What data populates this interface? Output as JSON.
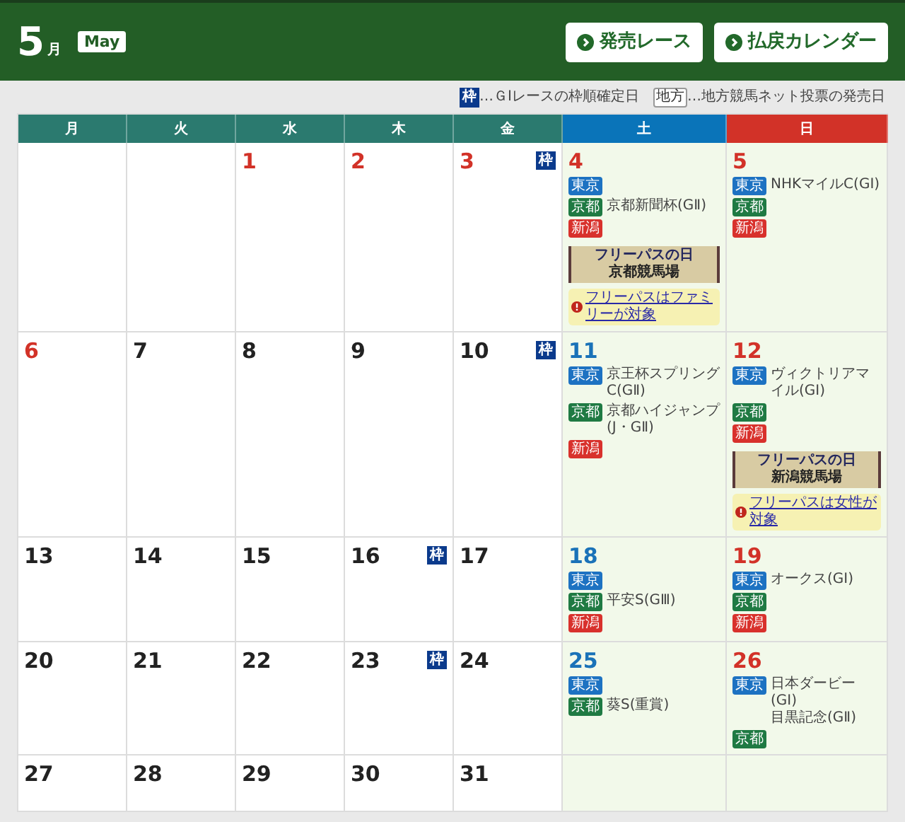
{
  "header": {
    "month": "5",
    "month_suffix": "月",
    "month_en": "May",
    "buttons": [
      "発売レース",
      "払戻カレンダー"
    ]
  },
  "legend": [
    {
      "kind": "waku",
      "badge": "枠",
      "text": "…ＧⅠレースの枠順確定日"
    },
    {
      "kind": "chiho",
      "badge": "地方",
      "text": "…地方競馬ネット投票の発売日"
    }
  ],
  "weekdays": [
    {
      "label": "月",
      "color": "#2b7a6f"
    },
    {
      "label": "火",
      "color": "#2b7a6f"
    },
    {
      "label": "水",
      "color": "#2b7a6f"
    },
    {
      "label": "木",
      "color": "#2b7a6f"
    },
    {
      "label": "金",
      "color": "#2b7a6f"
    },
    {
      "label": "土",
      "color": "#0a74b9"
    },
    {
      "label": "日",
      "color": "#d23228"
    }
  ],
  "weeks": [
    [
      {
        "kind": "blank"
      },
      {
        "kind": "blank"
      },
      {
        "day": "1",
        "color": "#d23228"
      },
      {
        "day": "2",
        "color": "#d23228"
      },
      {
        "day": "3",
        "color": "#d23228",
        "badge": "枠"
      },
      {
        "day": "4",
        "color": "#d23228",
        "venues": [
          {
            "name": "東京",
            "color": "#1d72c2"
          },
          {
            "name": "京都",
            "color": "#1f7a43",
            "races": [
              "京都新聞杯(GⅡ)"
            ]
          },
          {
            "name": "新潟",
            "color": "#d8312c"
          }
        ],
        "free_pass": {
          "title": "フリーパスの日",
          "venue": "京都競馬場",
          "note": "フリーパスはファミリーが対象"
        }
      },
      {
        "day": "5",
        "color": "#d23228",
        "venues": [
          {
            "name": "東京",
            "color": "#1d72c2",
            "races": [
              "NHKマイルC(GⅠ)"
            ]
          },
          {
            "name": "京都",
            "color": "#1f7a43"
          },
          {
            "name": "新潟",
            "color": "#d8312c"
          }
        ]
      }
    ],
    [
      {
        "day": "6",
        "color": "#d23228"
      },
      {
        "day": "7",
        "color": "#222222"
      },
      {
        "day": "8",
        "color": "#222222"
      },
      {
        "day": "9",
        "color": "#222222"
      },
      {
        "day": "10",
        "color": "#222222",
        "badge": "枠"
      },
      {
        "day": "11",
        "color": "#1a72b8",
        "venues": [
          {
            "name": "東京",
            "color": "#1d72c2",
            "races": [
              "京王杯スプリングC(GⅡ)"
            ]
          },
          {
            "name": "京都",
            "color": "#1f7a43",
            "races": [
              "京都ハイジャンプ(J・GⅡ)"
            ]
          },
          {
            "name": "新潟",
            "color": "#d8312c"
          }
        ]
      },
      {
        "day": "12",
        "color": "#d23228",
        "venues": [
          {
            "name": "東京",
            "color": "#1d72c2",
            "races": [
              "ヴィクトリアマイル(GⅠ)"
            ]
          },
          {
            "name": "京都",
            "color": "#1f7a43"
          },
          {
            "name": "新潟",
            "color": "#d8312c"
          }
        ],
        "free_pass": {
          "title": "フリーパスの日",
          "venue": "新潟競馬場",
          "note": "フリーパスは女性が対象"
        }
      }
    ],
    [
      {
        "day": "13",
        "color": "#222222"
      },
      {
        "day": "14",
        "color": "#222222"
      },
      {
        "day": "15",
        "color": "#222222"
      },
      {
        "day": "16",
        "color": "#222222",
        "badge": "枠"
      },
      {
        "day": "17",
        "color": "#222222"
      },
      {
        "day": "18",
        "color": "#1a72b8",
        "venues": [
          {
            "name": "東京",
            "color": "#1d72c2"
          },
          {
            "name": "京都",
            "color": "#1f7a43",
            "races": [
              "平安S(GⅢ)"
            ]
          },
          {
            "name": "新潟",
            "color": "#d8312c"
          }
        ]
      },
      {
        "day": "19",
        "color": "#d23228",
        "venues": [
          {
            "name": "東京",
            "color": "#1d72c2",
            "races": [
              "オークス(GⅠ)"
            ]
          },
          {
            "name": "京都",
            "color": "#1f7a43"
          },
          {
            "name": "新潟",
            "color": "#d8312c"
          }
        ]
      }
    ],
    [
      {
        "day": "20",
        "color": "#222222"
      },
      {
        "day": "21",
        "color": "#222222"
      },
      {
        "day": "22",
        "color": "#222222"
      },
      {
        "day": "23",
        "color": "#222222",
        "badge": "枠"
      },
      {
        "day": "24",
        "color": "#222222"
      },
      {
        "day": "25",
        "color": "#1a72b8",
        "venues": [
          {
            "name": "東京",
            "color": "#1d72c2"
          },
          {
            "name": "京都",
            "color": "#1f7a43",
            "races": [
              "葵S(重賞)"
            ]
          }
        ]
      },
      {
        "day": "26",
        "color": "#d23228",
        "venues": [
          {
            "name": "東京",
            "color": "#1d72c2",
            "races": [
              "日本ダービー(GⅠ)",
              "目黒記念(GⅡ)"
            ]
          },
          {
            "name": "京都",
            "color": "#1f7a43"
          }
        ]
      }
    ],
    [
      {
        "day": "27",
        "color": "#222222"
      },
      {
        "day": "28",
        "color": "#222222"
      },
      {
        "day": "29",
        "color": "#222222"
      },
      {
        "day": "30",
        "color": "#222222"
      },
      {
        "day": "31",
        "color": "#222222"
      },
      {
        "kind": "blank"
      },
      {
        "kind": "blank"
      }
    ]
  ]
}
